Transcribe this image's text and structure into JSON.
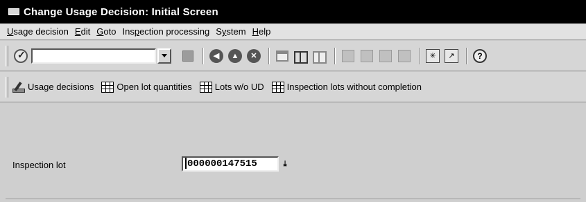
{
  "window": {
    "title": "Change Usage Decision: Initial Screen"
  },
  "menubar": {
    "items": [
      {
        "label": "Usage decision",
        "mnemonic": "U"
      },
      {
        "label": "Edit",
        "mnemonic": "E"
      },
      {
        "label": "Goto",
        "mnemonic": "G"
      },
      {
        "label": "Inspection processing",
        "mnemonic": "p"
      },
      {
        "label": "System",
        "mnemonic": "y"
      },
      {
        "label": "Help",
        "mnemonic": "H"
      }
    ]
  },
  "standard_toolbar": {
    "command_field_value": "",
    "icons": [
      "enter-icon",
      "save-icon",
      "back-icon",
      "exit-icon",
      "cancel-icon",
      "print-icon",
      "find-icon",
      "find-next-icon",
      "first-page-icon",
      "previous-page-icon",
      "next-page-icon",
      "last-page-icon",
      "create-session-icon",
      "generate-shortcut-icon",
      "help-icon"
    ]
  },
  "application_toolbar": {
    "buttons": [
      {
        "label": "Usage decisions",
        "icon": "pen-icon"
      },
      {
        "label": "Open lot quantities",
        "icon": "table-icon"
      },
      {
        "label": "Lots w/o UD",
        "icon": "table-icon"
      },
      {
        "label": "Inspection lots without completion",
        "icon": "table-icon"
      }
    ]
  },
  "form": {
    "inspection_lot_label": "Inspection lot",
    "inspection_lot_value": "000000147515"
  }
}
